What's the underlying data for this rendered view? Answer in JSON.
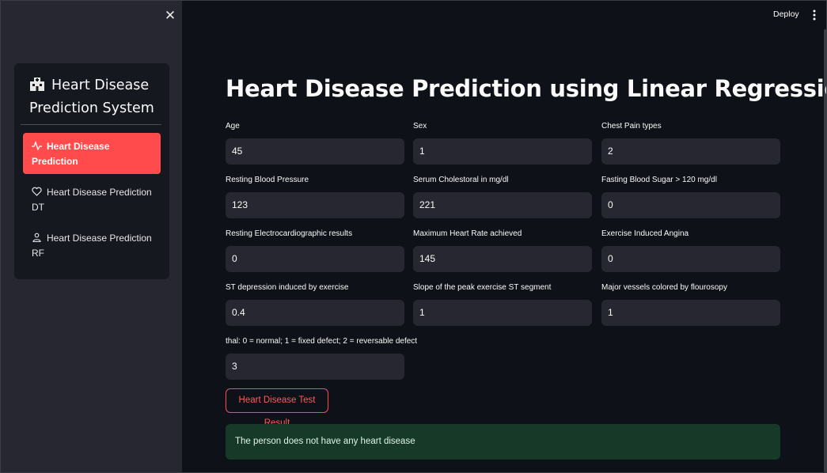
{
  "sidebar": {
    "title": "Heart Disease Prediction System",
    "title_icon": "hospital-icon",
    "close_icon": "close-icon",
    "items": [
      {
        "label": "Heart Disease Prediction",
        "icon": "activity-icon",
        "active": true
      },
      {
        "label": "Heart Disease Prediction DT",
        "icon": "heart-icon",
        "active": false
      },
      {
        "label": "Heart Disease Prediction RF",
        "icon": "person-icon",
        "active": false
      }
    ]
  },
  "header": {
    "deploy_label": "Deploy",
    "menu_icon": "kebab-menu-icon"
  },
  "main": {
    "title": "Heart Disease Prediction using Linear Regression",
    "fields": [
      {
        "label": "Age",
        "value": "45"
      },
      {
        "label": "Sex",
        "value": "1"
      },
      {
        "label": "Chest Pain types",
        "value": "2"
      },
      {
        "label": "Resting Blood Pressure",
        "value": "123"
      },
      {
        "label": "Serum Cholestoral in mg/dl",
        "value": "221"
      },
      {
        "label": "Fasting Blood Sugar > 120 mg/dl",
        "value": "0"
      },
      {
        "label": "Resting Electrocardiographic results",
        "value": "0"
      },
      {
        "label": "Maximum Heart Rate achieved",
        "value": "145"
      },
      {
        "label": "Exercise Induced Angina",
        "value": "0"
      },
      {
        "label": "ST depression induced by exercise",
        "value": "0.4"
      },
      {
        "label": "Slope of the peak exercise ST segment",
        "value": "1"
      },
      {
        "label": "Major vessels colored by flourosopy",
        "value": "1"
      },
      {
        "label": "thal: 0 = normal; 1 = fixed defect; 2 = reversable defect",
        "value": "3"
      }
    ],
    "button_label": "Heart Disease Test Result",
    "result_text": "The person does not have any heart disease"
  },
  "colors": {
    "accent": "#ff4b4b",
    "background": "#0e1117",
    "sidebar": "#262730",
    "success_bg": "#173928"
  }
}
